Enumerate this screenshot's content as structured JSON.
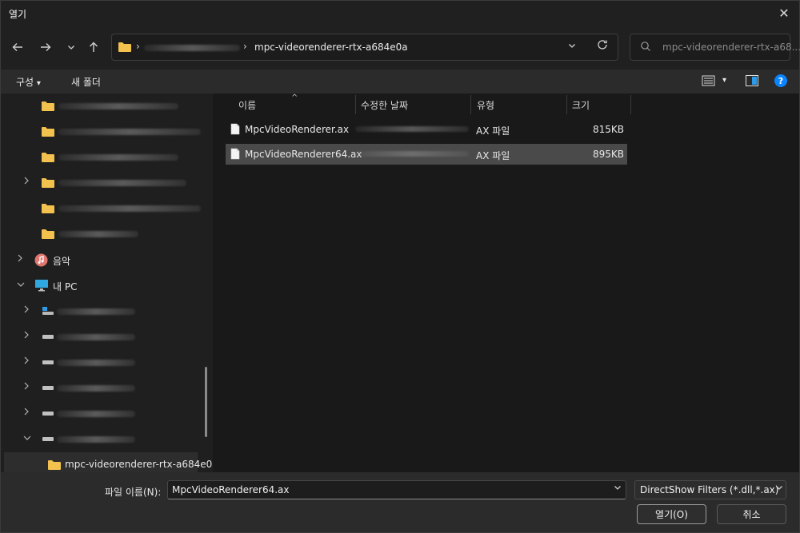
{
  "window": {
    "title": "열기",
    "close_glyph": "✕"
  },
  "nav": {
    "back_icon": "arrow-left-icon",
    "forward_icon": "arrow-right-icon",
    "recent_icon": "chevron-down-icon",
    "up_icon": "arrow-up-icon",
    "breadcrumb_sep": "›",
    "current_folder": "mpc-videorenderer-rtx-a684e0a",
    "dropdown_glyph": "⌄",
    "refresh_glyph": "↻"
  },
  "search": {
    "placeholder": "mpc-videorenderer-rtx-a68..."
  },
  "toolbar": {
    "organize_label": "구성",
    "organize_arrow": "▾",
    "new_folder_label": "새 폴더",
    "view_arrow": "▾"
  },
  "sidebar": {
    "music_label": "음악",
    "this_pc_label": "내 PC",
    "selected_folder_label": "mpc-videorenderer-rtx-a684e0"
  },
  "columns": {
    "name": "이름",
    "date": "수정한 날짜",
    "type": "유형",
    "size": "크기",
    "sort_caret": "^"
  },
  "files": [
    {
      "name": "MpcVideoRenderer.ax",
      "type": "AX 파일",
      "size": "815KB",
      "selected": false
    },
    {
      "name": "MpcVideoRenderer64.ax",
      "type": "AX 파일",
      "size": "895KB",
      "selected": true
    }
  ],
  "bottom": {
    "filename_label": "파일 이름(N):",
    "filename_value": "MpcVideoRenderer64.ax",
    "filter_value": "DirectShow Filters (*.dll,*.ax)",
    "open_label": "열기(O)",
    "cancel_label": "취소"
  },
  "colors": {
    "accent": "#0a84ff",
    "folder": "#f2c14e",
    "selection": "#4a4a4a"
  }
}
